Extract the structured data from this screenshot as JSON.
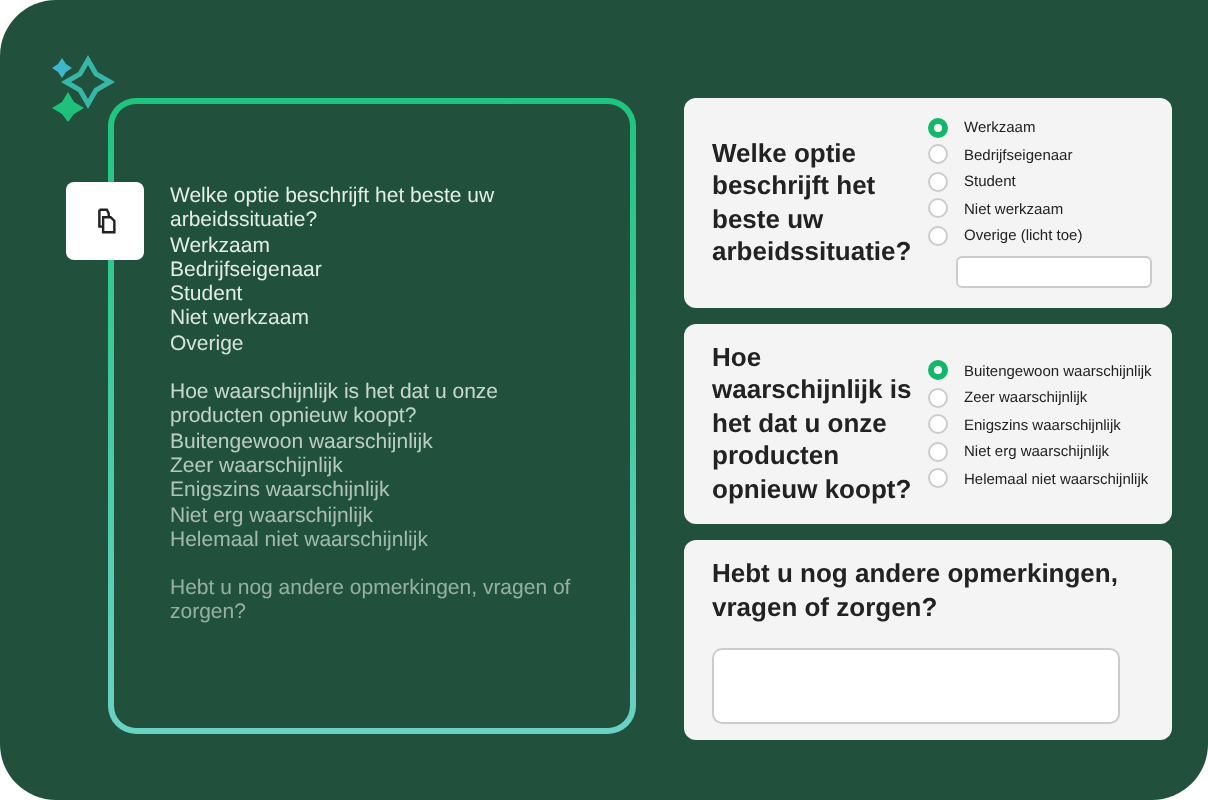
{
  "transcript": [
    {
      "question": "Welke optie beschrijft het beste uw arbeidssituatie?",
      "options": [
        "Werkzaam",
        "Bedrijfseigenaar",
        "Student",
        "Niet werkzaam",
        "Overige"
      ]
    },
    {
      "question": "Hoe waarschijnlijk is het dat u onze producten opnieuw koopt?",
      "options": [
        "Buitengewoon waarschijnlijk",
        "Zeer waarschijnlijk",
        "Enigszins waarschijnlijk",
        "Niet erg waarschijnlijk",
        "Helemaal niet waarschijnlijk"
      ]
    },
    {
      "question": "Hebt u nog andere opmerkingen, vragen of zorgen?"
    }
  ],
  "cards": [
    {
      "kind": "radio",
      "question": "Welke optie beschrijft het beste uw arbeidssituatie?",
      "has_field": true,
      "options": [
        {
          "label": "Werkzaam",
          "selected": true
        },
        {
          "label": "Bedrijfseigenaar",
          "selected": false
        },
        {
          "label": "Student",
          "selected": false
        },
        {
          "label": "Niet werkzaam",
          "selected": false
        },
        {
          "label": "Overige (licht toe)",
          "selected": false
        }
      ]
    },
    {
      "kind": "radio",
      "question": "Hoe waarschijnlijk is het dat u onze producten opnieuw koopt?",
      "options": [
        {
          "label": "Buitengewoon waarschijnlijk",
          "selected": true
        },
        {
          "label": "Zeer waarschijnlijk",
          "selected": false
        },
        {
          "label": "Enigszins waarschijnlijk",
          "selected": false
        },
        {
          "label": "Niet erg waarschijnlijk",
          "selected": false
        },
        {
          "label": "Helemaal niet waarschijnlijk",
          "selected": false
        }
      ]
    },
    {
      "kind": "text",
      "question": "Hebt u nog andere opmerkingen, vragen of zorgen?"
    }
  ]
}
